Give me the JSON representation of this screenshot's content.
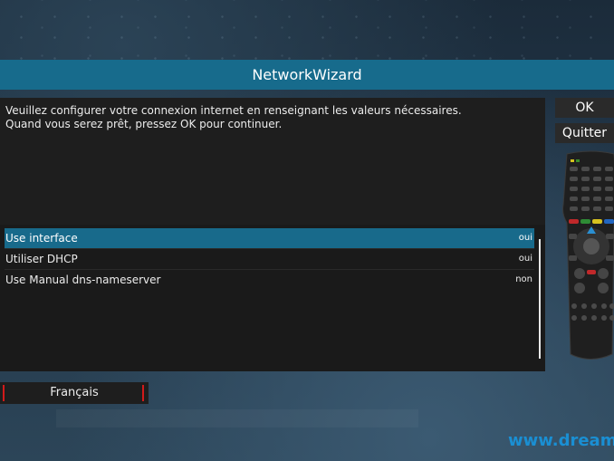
{
  "header": {
    "title": "NetworkWizard"
  },
  "info": {
    "line1": "Veuillez configurer votre connexion internet en renseignant les valeurs nécessaires.",
    "line2": "Quand vous serez prêt, pressez OK pour continuer."
  },
  "settings": {
    "items": [
      {
        "label": "Use interface",
        "value": "oui"
      },
      {
        "label": "Utiliser DHCP",
        "value": "oui"
      },
      {
        "label": "Use Manual dns-nameserver",
        "value": "non"
      }
    ]
  },
  "buttons": {
    "ok_label": "OK",
    "quit_label": "Quitter",
    "language_label": "Français"
  },
  "footer": {
    "brand_text": "www.dream"
  },
  "colors": {
    "accent": "#176b8c",
    "selection": "#186a8b",
    "language_marker": "#d21a1a",
    "brand": "#1a8fd3"
  },
  "icons": {
    "remote": "remote-control-icon"
  }
}
